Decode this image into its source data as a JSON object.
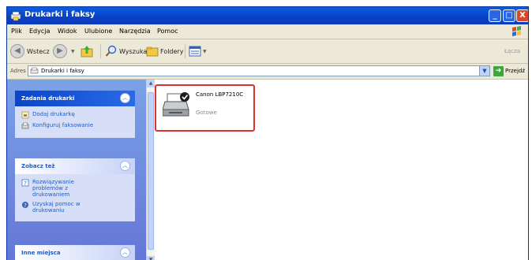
{
  "window": {
    "title": "Drukarki i faksy",
    "controls": [
      "_",
      "□",
      "X"
    ]
  },
  "menubar": {
    "items": [
      "Plik",
      "Edycja",
      "Widok",
      "Ulubione",
      "Narzędzia",
      "Pomoc"
    ]
  },
  "toolbar": {
    "back": "Wstecz",
    "forward": "",
    "search": "Wyszukaj",
    "folders": "Foldery",
    "links": "Łącza"
  },
  "addressbar": {
    "label": "Adres",
    "value": "Drukarki i faksy",
    "go": "Przejdź"
  },
  "leftpane": {
    "panels": [
      {
        "title": "Zadania drukarki",
        "items": [
          "Dodaj drukarkę",
          "Konfiguruj faksowanie"
        ]
      },
      {
        "title": "Zobacz też",
        "items": [
          "Rozwiązywanie problemów z drukowaniem",
          "Uzyskaj pomoc w drukowaniu"
        ]
      },
      {
        "title": "Inne miejsca",
        "items": []
      }
    ]
  },
  "printer": {
    "name": "Canon LBP7210C",
    "status": "Gotowe"
  },
  "colors": {
    "titlebar": "#0a4fd4",
    "highlight": "#e0312b",
    "pane": "#6f8ddf"
  }
}
